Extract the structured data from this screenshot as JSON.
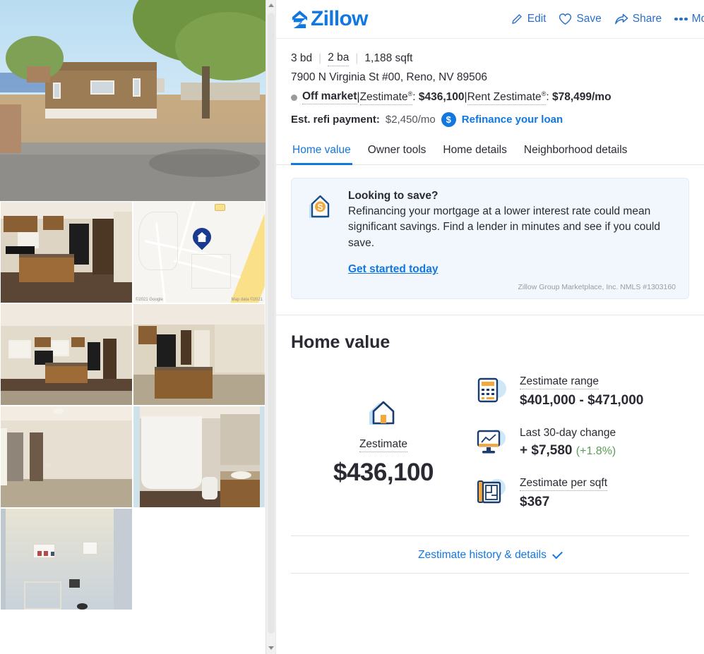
{
  "brand": {
    "name": "Zillow",
    "color": "#1277e1"
  },
  "header": {
    "actions": [
      {
        "label": "Edit",
        "icon": "pencil-icon"
      },
      {
        "label": "Save",
        "icon": "heart-icon"
      },
      {
        "label": "Share",
        "icon": "share-arrow-icon"
      },
      {
        "label": "More",
        "icon": "ellipsis-icon"
      }
    ]
  },
  "property": {
    "beds": "3 bd",
    "baths": "2 ba",
    "sqft": "1,188 sqft",
    "address": "7900 N Virginia St #00, Reno, NV 89506",
    "status": "Off market",
    "zestimate_label": "Zestimate",
    "zestimate_sup": "®",
    "zestimate_value": "$436,100",
    "rent_label": "Rent Zestimate",
    "rent_sup": "®",
    "rent_value": "$78,499/mo",
    "refi_label": "Est. refi payment:",
    "refi_amount": "$2,450/mo",
    "refi_badge": "$",
    "refi_link": "Refinance your loan"
  },
  "tabs": [
    {
      "label": "Home value",
      "active": true
    },
    {
      "label": "Owner tools",
      "active": false
    },
    {
      "label": "Home details",
      "active": false
    },
    {
      "label": "Neighborhood details",
      "active": false
    }
  ],
  "promo": {
    "icon": "house-dollar-icon",
    "title": "Looking to save?",
    "text": "Refinancing your mortgage at a lower interest rate could mean significant savings. Find a lender in minutes and see if you could save.",
    "cta": "Get started today",
    "disclaimer": "Zillow Group Marketplace, Inc. NMLS #1303160"
  },
  "home_value": {
    "title": "Home value",
    "zestimate_icon": "house-icon",
    "zestimate_label": "Zestimate",
    "zestimate_value": "$436,100",
    "stats": [
      {
        "icon": "calculator-icon",
        "label": "Zestimate range",
        "value": "$401,000 - $471,000",
        "delta": "",
        "delta_color": ""
      },
      {
        "icon": "monitor-chart-icon",
        "label": "Last 30-day change",
        "value": "+ $7,580",
        "delta": "(+1.8%)",
        "delta_color": "#5a9e54"
      },
      {
        "icon": "blueprint-icon",
        "label": "Zestimate per sqft",
        "value": "$367",
        "delta": "",
        "delta_color": ""
      }
    ],
    "history_link": "Zestimate history & details"
  },
  "gallery": {
    "photos": [
      {
        "name": "exterior-front",
        "alt": "Tan manufactured home exterior with tree and gravel driveway"
      },
      {
        "name": "kitchen-island",
        "alt": "Kitchen with wood cabinets, black appliances and island"
      },
      {
        "name": "location-map",
        "alt": "Map showing property location"
      },
      {
        "name": "living-kitchen",
        "alt": "Open living area looking toward kitchen"
      },
      {
        "name": "living-room",
        "alt": "Living room with kitchen island and carpet"
      },
      {
        "name": "bedroom",
        "alt": "Bedroom with closet and ensuite doorways"
      },
      {
        "name": "bathroom",
        "alt": "Bathroom with tub shower, toilet and vanity"
      },
      {
        "name": "laundry-room",
        "alt": "Laundry room with hookups"
      }
    ],
    "map": {
      "credit_left": "©2021 Google",
      "credit_right": "Map data ©2021",
      "highway_shield": "395",
      "pin": "home-pin-icon"
    },
    "scrollbar": {
      "up": "scroll-up-arrow",
      "down": "scroll-down-arrow"
    }
  }
}
